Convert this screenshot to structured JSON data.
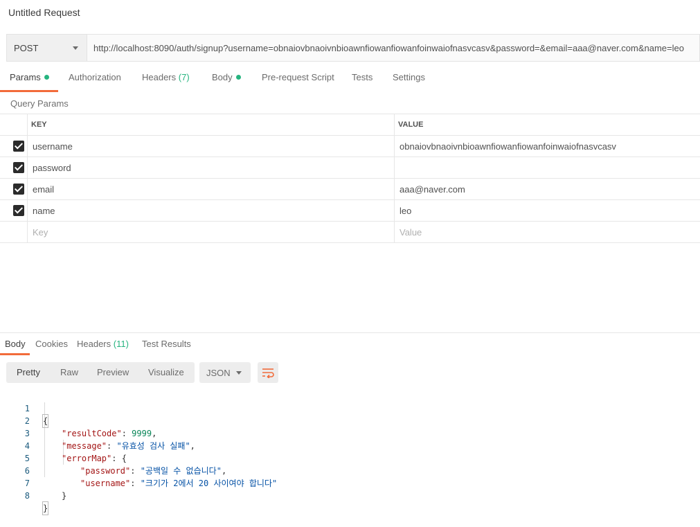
{
  "request": {
    "title": "Untitled Request",
    "method": "POST",
    "url": "http://localhost:8090/auth/signup?username=obnaiovbnaoivnbioawnfiowanfiowanfoinwaiofnasvcasv&password=&email=aaa@naver.com&name=leo"
  },
  "tabs": {
    "params": "Params",
    "authorization": "Authorization",
    "headers": "Headers",
    "headers_count": "(7)",
    "body": "Body",
    "prerequest": "Pre-request Script",
    "tests": "Tests",
    "settings": "Settings"
  },
  "query": {
    "label": "Query Params",
    "key_header": "KEY",
    "value_header": "VALUE",
    "rows": [
      {
        "key": "username",
        "value": "obnaiovbnaoivnbioawnfiowanfiowanfoinwaiofnasvcasv",
        "checked": true
      },
      {
        "key": "password",
        "value": "",
        "checked": true
      },
      {
        "key": "email",
        "value": "aaa@naver.com",
        "checked": true
      },
      {
        "key": "name",
        "value": "leo",
        "checked": true
      }
    ],
    "key_placeholder": "Key",
    "value_placeholder": "Value"
  },
  "response": {
    "tabs": {
      "body": "Body",
      "cookies": "Cookies",
      "headers": "Headers",
      "headers_count": "(11)",
      "test_results": "Test Results"
    },
    "views": {
      "pretty": "Pretty",
      "raw": "Raw",
      "preview": "Preview",
      "visualize": "Visualize"
    },
    "format": "JSON",
    "lines": {
      "l1": "{",
      "l2_key": "\"resultCode\"",
      "l2_val": "9999",
      "l3_key": "\"message\"",
      "l3_val": "\"유효성 검사 실패\"",
      "l4_key": "\"errorMap\"",
      "l4_val": "{",
      "l5_key": "\"password\"",
      "l5_val": "\"공백일 수 없습니다\"",
      "l6_key": "\"username\"",
      "l6_val": "\"크기가 2에서 20 사이여야 합니다\"",
      "l7": "}",
      "l8": "}"
    },
    "line_numbers": [
      "1",
      "2",
      "3",
      "4",
      "5",
      "6",
      "7",
      "8"
    ]
  },
  "colors": {
    "accent": "#f26b3a",
    "success": "#26b47f"
  }
}
